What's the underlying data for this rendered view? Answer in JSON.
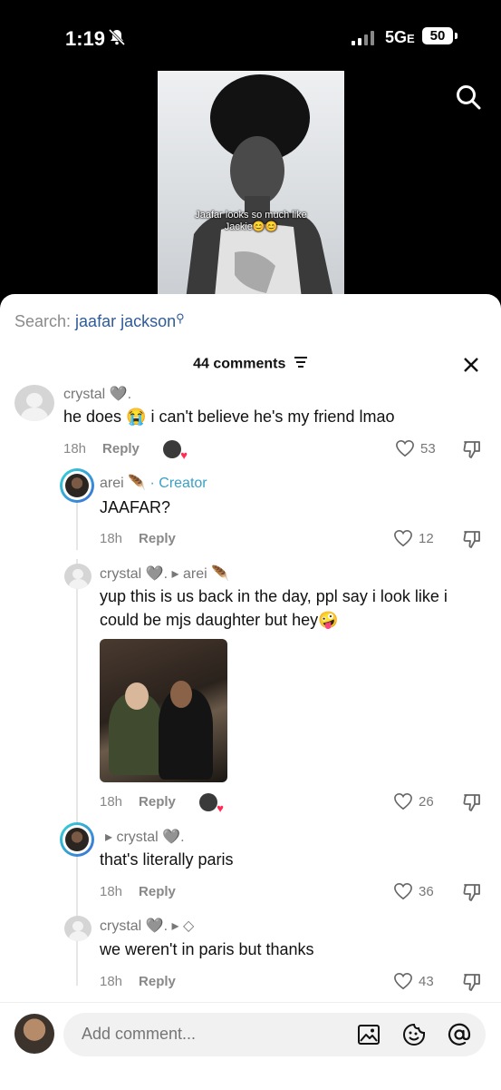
{
  "status_bar": {
    "time": "1:19",
    "network": "5G",
    "network_suffix": "E",
    "battery": "50"
  },
  "video": {
    "caption_line1": "Jaafar looks so much like",
    "caption_line2": "Jackie😊😊"
  },
  "sheet": {
    "search_label": "Search: ",
    "search_query": "jaafar jackson",
    "comment_count": "44 comments"
  },
  "comments": [
    {
      "user": "crystal 🩶.",
      "text": "he does 😭  i can't believe he's my friend lmao",
      "time": "18h",
      "reply": "Reply",
      "likes": "53"
    },
    {
      "user": "arei 🪶",
      "badge": "· Creator",
      "text": "JAAFAR?",
      "time": "18h",
      "reply": "Reply",
      "likes": "12"
    },
    {
      "user": "crystal 🩶.",
      "reply_to": "▸ arei 🪶",
      "text_line1": "yup this is us back in the day, ppl say i look like i",
      "text_line2": "could be mjs daughter but hey🤪",
      "time": "18h",
      "reply": "Reply",
      "likes": "26"
    },
    {
      "reply_to": "▸ crystal 🩶.",
      "text": "that's literally paris",
      "time": "18h",
      "reply": "Reply",
      "likes": "36"
    },
    {
      "user": "crystal 🩶.",
      "reply_to": "▸ ◇",
      "text": "we weren't in paris but thanks",
      "time": "18h",
      "reply": "Reply",
      "likes": "43"
    }
  ],
  "composer": {
    "placeholder": "Add comment..."
  },
  "icons": [
    "bell-slash-icon",
    "search-icon",
    "close-icon",
    "sort-icon",
    "heart-icon",
    "thumbs-down-icon",
    "image-icon",
    "emoji-icon",
    "mention-icon"
  ]
}
